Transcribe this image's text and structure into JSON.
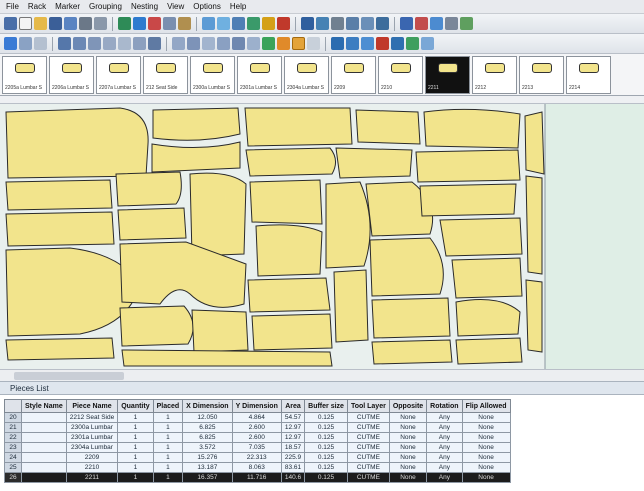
{
  "menu": [
    "File",
    "Rack",
    "Marker",
    "Grouping",
    "Nesting",
    "View",
    "Options",
    "Help"
  ],
  "colors": {
    "piece_fill": "#f2e48c",
    "piece_stroke": "#2a2a2a",
    "canvas_bg": "#dfeee6",
    "selected_row": "#1c1c1c"
  },
  "thumbnails": [
    {
      "label": "2205a Lumbar S",
      "selected": false
    },
    {
      "label": "2206a Lumbar S",
      "selected": false
    },
    {
      "label": "2207a Lumbar S",
      "selected": false
    },
    {
      "label": "212 Seat Side",
      "selected": false
    },
    {
      "label": "2300a Lumbar S",
      "selected": false
    },
    {
      "label": "2301a Lumbar S",
      "selected": false
    },
    {
      "label": "2304a Lumbar S",
      "selected": false
    },
    {
      "label": "2209",
      "selected": false
    },
    {
      "label": "2210",
      "selected": false
    },
    {
      "label": "2211",
      "selected": true
    },
    {
      "label": "2212",
      "selected": false
    },
    {
      "label": "2213",
      "selected": false
    },
    {
      "label": "2214",
      "selected": false
    }
  ],
  "pieces_panel_title": "Pieces List",
  "pieces_table": {
    "columns": [
      "",
      "Style Name",
      "Piece Name",
      "Quantity",
      "Placed",
      "X Dimension",
      "Y Dimension",
      "Area",
      "Buffer size",
      "Tool Layer",
      "Opposite",
      "Rotation",
      "Flip Allowed"
    ],
    "rows": [
      [
        "20",
        "",
        "2212 Seat Side",
        "1",
        "1",
        "12.050",
        "4.864",
        "54.57",
        "0.125",
        "CUTME",
        "None",
        "Any",
        "None"
      ],
      [
        "21",
        "",
        "2300a Lumbar",
        "1",
        "1",
        "6.825",
        "2.600",
        "12.97",
        "0.125",
        "CUTME",
        "None",
        "Any",
        "None"
      ],
      [
        "22",
        "",
        "2301a Lumbar",
        "1",
        "1",
        "6.825",
        "2.600",
        "12.97",
        "0.125",
        "CUTME",
        "None",
        "Any",
        "None"
      ],
      [
        "23",
        "",
        "2304a Lumbar",
        "1",
        "1",
        "3.572",
        "7.035",
        "18.57",
        "0.125",
        "CUTME",
        "None",
        "Any",
        "None"
      ],
      [
        "24",
        "",
        "2209",
        "1",
        "1",
        "15.276",
        "22.313",
        "225.9",
        "0.125",
        "CUTME",
        "None",
        "Any",
        "None"
      ],
      [
        "25",
        "",
        "2210",
        "1",
        "1",
        "13.187",
        "8.063",
        "83.61",
        "0.125",
        "CUTME",
        "None",
        "Any",
        "None"
      ],
      [
        "26",
        "",
        "2211",
        "1",
        "1",
        "16.357",
        "11.716",
        "140.6",
        "0.125",
        "CUTME",
        "None",
        "Any",
        "None"
      ]
    ],
    "selected_row_index": 6
  }
}
